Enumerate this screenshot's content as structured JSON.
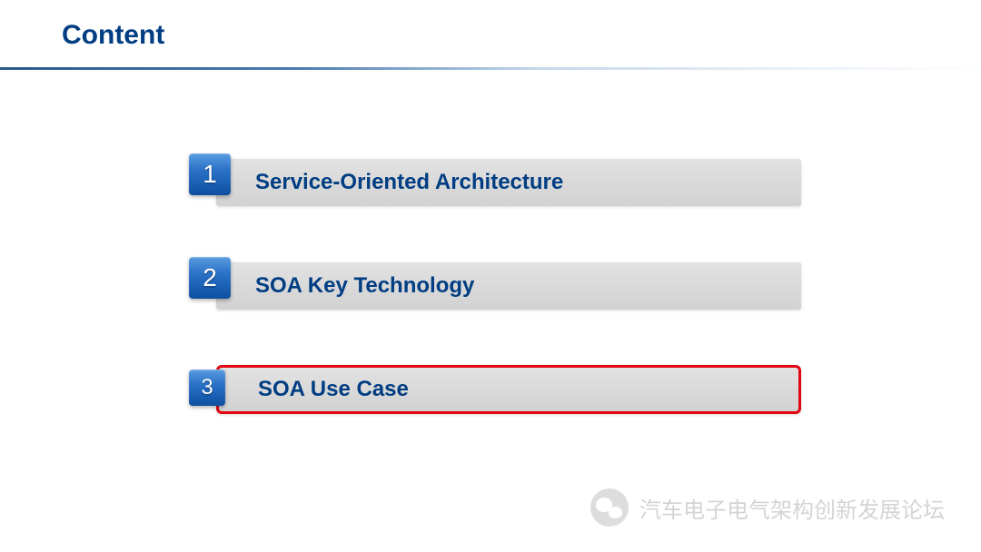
{
  "header": {
    "title": "Content"
  },
  "items": [
    {
      "number": "1",
      "label": "Service-Oriented Architecture",
      "highlighted": false
    },
    {
      "number": "2",
      "label": "SOA Key Technology",
      "highlighted": false
    },
    {
      "number": "3",
      "label": "SOA Use Case",
      "highlighted": true
    }
  ],
  "watermark": {
    "text": "汽车电子电气架构创新发展论坛"
  }
}
